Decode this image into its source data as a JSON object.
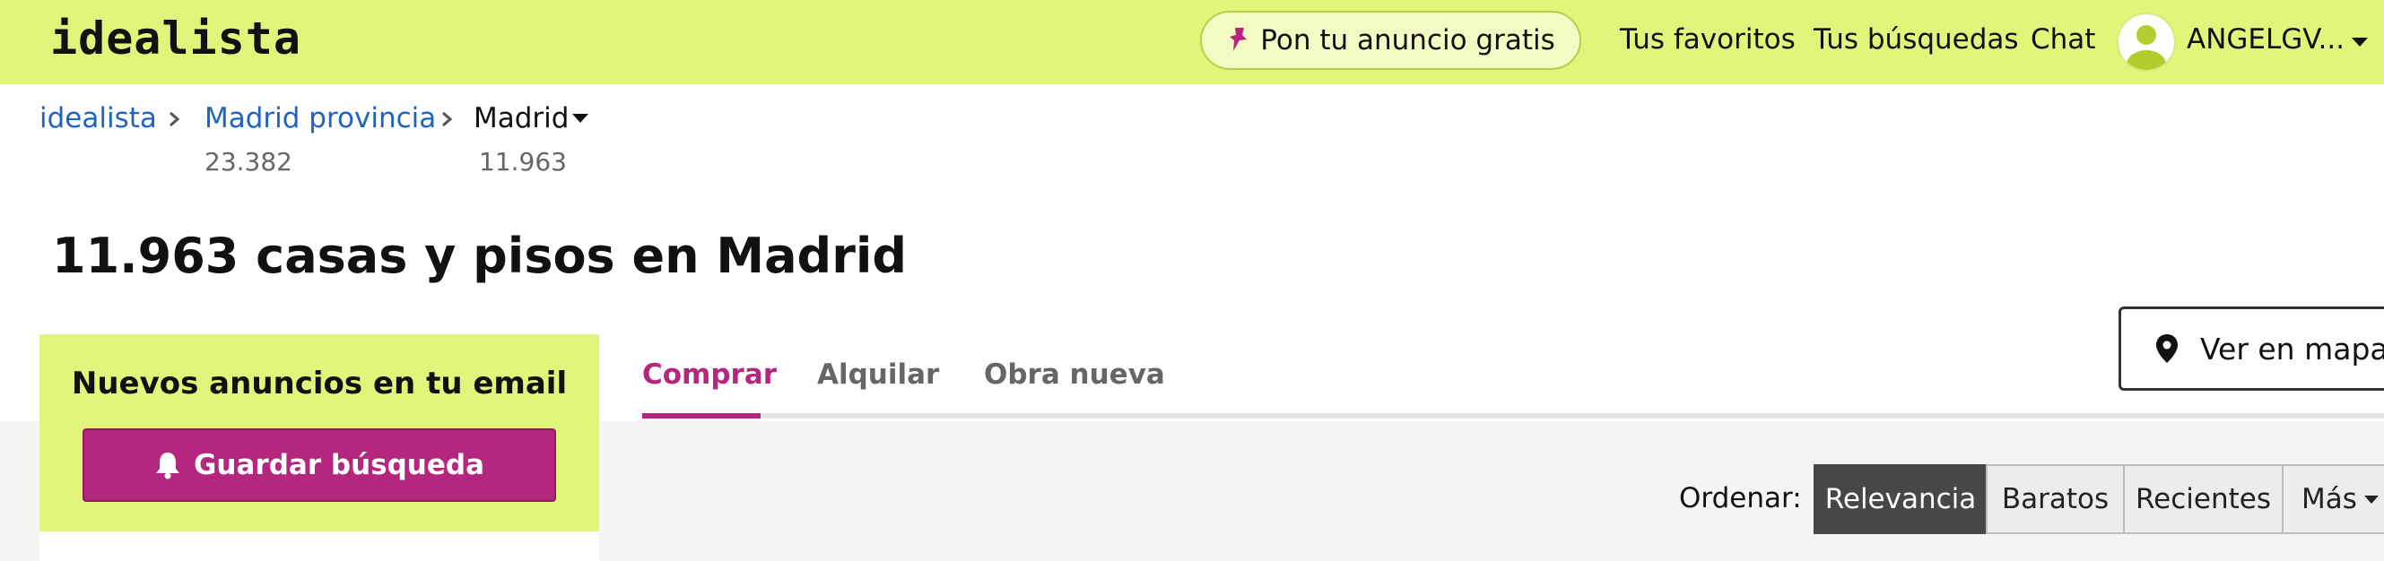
{
  "header": {
    "logo": "idealista",
    "publish_label": "Pon tu anuncio gratis",
    "nav": {
      "favorites": "Tus favoritos",
      "searches": "Tus búsquedas",
      "chat": "Chat"
    },
    "user_name": "ANGELGV...",
    "icons": {
      "publish": "pushpin-icon",
      "avatar": "user-avatar-icon",
      "user_menu": "caret-down-icon"
    }
  },
  "breadcrumb": {
    "items": [
      {
        "label": "idealista"
      },
      {
        "label": "Madrid provincia",
        "count": "23.382"
      },
      {
        "label": "Madrid",
        "count": "11.963"
      }
    ]
  },
  "page_title": "11.963 casas y pisos en Madrid",
  "alert": {
    "title": "Nuevos anuncios en tu email",
    "button_label": "Guardar búsqueda",
    "icon": "bell-icon"
  },
  "tabs": [
    {
      "label": "Comprar",
      "active": true
    },
    {
      "label": "Alquilar",
      "active": false
    },
    {
      "label": "Obra nueva",
      "active": false
    }
  ],
  "map_button": {
    "label": "Ver en mapa",
    "icon": "map-marker-icon"
  },
  "sort": {
    "label": "Ordenar:",
    "options": [
      "Relevancia",
      "Baratos",
      "Recientes",
      "Más"
    ],
    "selected": "Relevancia"
  },
  "colors": {
    "brand_lime": "#e1f57a",
    "accent_magenta": "#b5267f",
    "link_blue": "#1e64c0",
    "selected_sort": "#474747"
  }
}
